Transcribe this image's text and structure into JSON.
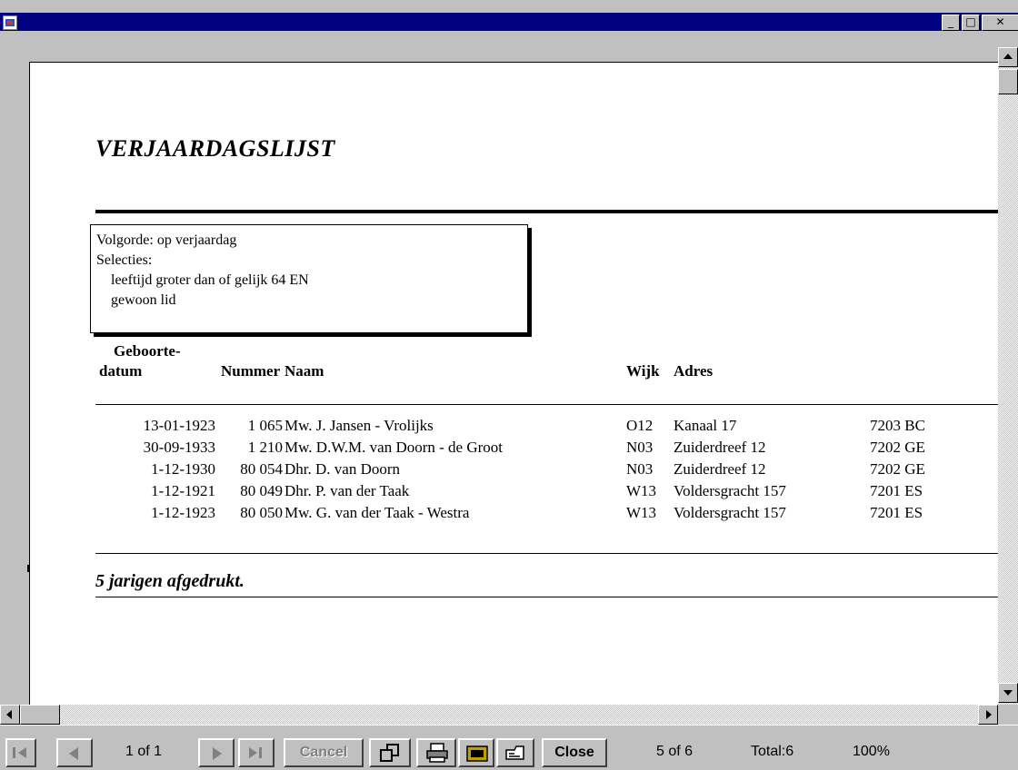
{
  "window": {
    "min_label": "_",
    "max_label": "□",
    "close_label": "✕"
  },
  "report": {
    "title": "VERJAARDAGSLIJST",
    "criteria": {
      "order": "Volgorde: op verjaardag",
      "selections_label": "Selecties:",
      "selection_1": "leeftijd groter dan of gelijk 64 EN",
      "selection_2": "gewoon lid"
    },
    "headers": {
      "date_line1": "Geboorte-",
      "date_line2": "datum",
      "number": "Nummer",
      "name": "Naam",
      "wijk": "Wijk",
      "adres": "Adres"
    },
    "rows": [
      {
        "date": "13-01-1923",
        "number": "1 065",
        "name": "Mw. J. Jansen - Vrolijks",
        "wijk": "O12",
        "adres": "Kanaal 17",
        "postcode": "7203 BC"
      },
      {
        "date": "30-09-1933",
        "number": "1 210",
        "name": "Mw. D.W.M. van Doorn - de Groot",
        "wijk": "N03",
        "adres": "Zuiderdreef 12",
        "postcode": "7202 GE"
      },
      {
        "date": "1-12-1930",
        "number": "80 054",
        "name": "Dhr. D. van Doorn",
        "wijk": "N03",
        "adres": "Zuiderdreef 12",
        "postcode": "7202 GE"
      },
      {
        "date": "1-12-1921",
        "number": "80 049",
        "name": "Dhr. P. van der Taak",
        "wijk": "W13",
        "adres": "Voldersgracht 157",
        "postcode": "7201 ES"
      },
      {
        "date": "1-12-1923",
        "number": "80 050",
        "name": "Mw. G. van der Taak - Westra",
        "wijk": "W13",
        "adres": "Voldersgracht 157",
        "postcode": "7201 ES"
      }
    ],
    "footer": "5 jarigen afgedrukt."
  },
  "toolbar": {
    "page_indicator": "1 of 1",
    "cancel_label": "Cancel",
    "close_label": "Close",
    "record_status": "5 of 6",
    "total": "Total:6",
    "zoom": "100%"
  }
}
